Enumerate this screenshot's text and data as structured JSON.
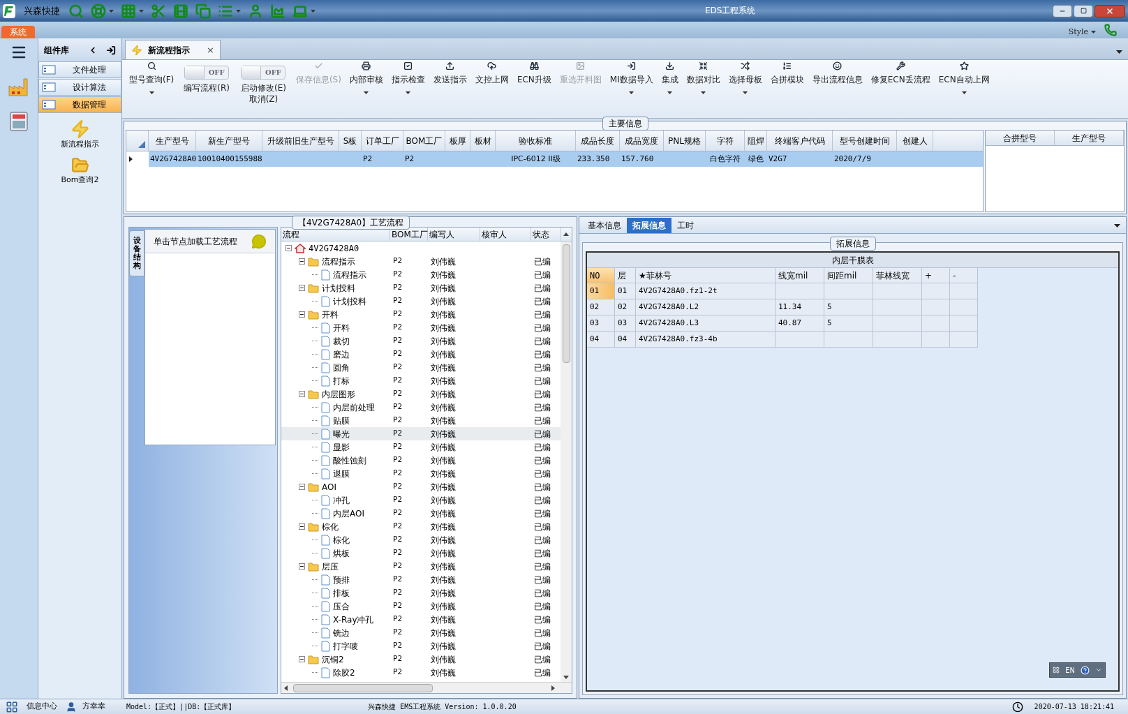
{
  "app": {
    "brand": "兴森快捷",
    "title": "EDS工程系统",
    "menu": "系统",
    "style": "Style"
  },
  "quick_icons": [
    {
      "dropdown": false
    },
    {
      "dropdown": true
    },
    {
      "dropdown": true
    },
    {
      "dropdown": false
    },
    {
      "dropdown": false
    },
    {
      "dropdown": false
    },
    {
      "dropdown": true
    },
    {
      "dropdown": false
    },
    {
      "dropdown": false
    },
    {
      "dropdown": true
    }
  ],
  "component_panel": {
    "title": "组件库",
    "items": [
      {
        "label": "文件处理",
        "selected": false
      },
      {
        "label": "设计算法",
        "selected": false
      },
      {
        "label": "数据管理",
        "selected": true
      }
    ],
    "launchers": [
      {
        "label": "新流程指示"
      },
      {
        "label": "Bom查询2"
      }
    ]
  },
  "doc_tabs": [
    {
      "label": "新流程指示",
      "selected": true,
      "close": "×"
    }
  ],
  "toolbar": [
    {
      "kind": "button",
      "label": "型号查询(F)",
      "dropdown": true,
      "disabled": false
    },
    {
      "kind": "toggle",
      "label": "编写流程(R)",
      "on": false,
      "state_text": "OFF"
    },
    {
      "kind": "toggle",
      "label": "启动修改(E)\n取消(Z)",
      "on": false,
      "state_text": "OFF"
    },
    {
      "kind": "button",
      "label": "保存信息(S)",
      "dropdown": false,
      "disabled": true
    },
    {
      "kind": "button",
      "label": "内部审核",
      "dropdown": true,
      "disabled": false
    },
    {
      "kind": "button",
      "label": "指示检查",
      "dropdown": true,
      "disabled": false
    },
    {
      "kind": "button",
      "label": "发送指示",
      "dropdown": false,
      "disabled": false
    },
    {
      "kind": "button",
      "label": "文控上网",
      "dropdown": false,
      "disabled": false
    },
    {
      "kind": "button",
      "label": "ECN升级",
      "dropdown": false,
      "disabled": false
    },
    {
      "kind": "button",
      "label": "重选开料图",
      "dropdown": false,
      "disabled": true
    },
    {
      "kind": "button",
      "label": "MI数据导入",
      "dropdown": true,
      "disabled": false
    },
    {
      "kind": "button",
      "label": "集成",
      "dropdown": true,
      "disabled": false
    },
    {
      "kind": "button",
      "label": "数据对比",
      "dropdown": true,
      "disabled": false
    },
    {
      "kind": "button",
      "label": "选择母板",
      "dropdown": true,
      "disabled": false
    },
    {
      "kind": "button",
      "label": "合拼模块",
      "dropdown": false,
      "disabled": false
    },
    {
      "kind": "button",
      "label": "导出流程信息",
      "dropdown": false,
      "disabled": false
    },
    {
      "kind": "button",
      "label": "修复ECN丢流程",
      "dropdown": false,
      "disabled": false
    },
    {
      "kind": "button",
      "label": "ECN自动上网",
      "dropdown": true,
      "disabled": false
    }
  ],
  "main_info": {
    "title": "主要信息",
    "columns": [
      "生产型号",
      "新生产型号",
      "升级前旧生产型号",
      "S板",
      "订单工厂",
      "BOM工厂",
      "板厚",
      "板材",
      "验收标准",
      "成品长度",
      "成品宽度",
      "PNL规格",
      "字符",
      "阻焊",
      "终端客户代码",
      "型号创建时间",
      "创建人"
    ],
    "rows": [
      {
        "selected": true,
        "cells": [
          "4V2G7428A0",
          "10010400155988",
          "",
          "",
          "P2",
          "P2",
          "",
          "",
          "IPC-6012 II级",
          "233.350",
          "157.760",
          "",
          "白色字符",
          "绿色",
          "V2G7",
          "2020/7/9",
          ""
        ]
      }
    ],
    "side_columns": [
      "合拼型号",
      "生产型号"
    ]
  },
  "process": {
    "title": "【4V2G7428A0】工艺流程",
    "side_tab": "设备结构",
    "hint": "单击节点加载工艺流程",
    "columns": [
      "流程",
      "BOM工厂",
      "编写人",
      "核审人",
      "状态"
    ],
    "tree": [
      {
        "label": "4V2G7428A0",
        "kind": "root",
        "expanded": true,
        "selected": false,
        "children": [
          {
            "label": "流程指示",
            "kind": "folder",
            "expanded": true,
            "selected": false,
            "bom": "P2",
            "writer": "刘伟巍",
            "status": "已编",
            "children": [
              {
                "label": "流程指示",
                "kind": "file",
                "selected": false,
                "bom": "P2",
                "writer": "刘伟巍",
                "status": "已编"
              }
            ]
          },
          {
            "label": "计划投料",
            "kind": "folder",
            "expanded": true,
            "selected": false,
            "bom": "P2",
            "writer": "刘伟巍",
            "status": "已编",
            "children": [
              {
                "label": "计划投料",
                "kind": "file",
                "selected": false,
                "bom": "P2",
                "writer": "刘伟巍",
                "status": "已编"
              }
            ]
          },
          {
            "label": "开料",
            "kind": "folder",
            "expanded": true,
            "selected": false,
            "bom": "P2",
            "writer": "刘伟巍",
            "status": "已编",
            "children": [
              {
                "label": "开料",
                "kind": "file",
                "selected": false,
                "bom": "P2",
                "writer": "刘伟巍",
                "status": "已编"
              },
              {
                "label": "裁切",
                "kind": "file",
                "selected": false,
                "bom": "P2",
                "writer": "刘伟巍",
                "status": "已编"
              },
              {
                "label": "磨边",
                "kind": "file",
                "selected": false,
                "bom": "P2",
                "writer": "刘伟巍",
                "status": "已编"
              },
              {
                "label": "圆角",
                "kind": "file",
                "selected": false,
                "bom": "P2",
                "writer": "刘伟巍",
                "status": "已编"
              },
              {
                "label": "打标",
                "kind": "file",
                "selected": false,
                "bom": "P2",
                "writer": "刘伟巍",
                "status": "已编"
              }
            ]
          },
          {
            "label": "内层图形",
            "kind": "folder",
            "expanded": true,
            "selected": false,
            "bom": "P2",
            "writer": "刘伟巍",
            "status": "已编",
            "children": [
              {
                "label": "内层前处理",
                "kind": "file",
                "selected": false,
                "bom": "P2",
                "writer": "刘伟巍",
                "status": "已编"
              },
              {
                "label": "贴膜",
                "kind": "file",
                "selected": false,
                "bom": "P2",
                "writer": "刘伟巍",
                "status": "已编"
              },
              {
                "label": "曝光",
                "kind": "file",
                "selected": true,
                "bom": "P2",
                "writer": "刘伟巍",
                "status": "已编"
              },
              {
                "label": "显影",
                "kind": "file",
                "selected": false,
                "bom": "P2",
                "writer": "刘伟巍",
                "status": "已编"
              },
              {
                "label": "酸性蚀刻",
                "kind": "file",
                "selected": false,
                "bom": "P2",
                "writer": "刘伟巍",
                "status": "已编"
              },
              {
                "label": "退膜",
                "kind": "file",
                "selected": false,
                "bom": "P2",
                "writer": "刘伟巍",
                "status": "已编"
              }
            ]
          },
          {
            "label": "AOI",
            "kind": "folder",
            "expanded": true,
            "selected": false,
            "bom": "P2",
            "writer": "刘伟巍",
            "status": "已编",
            "children": [
              {
                "label": "冲孔",
                "kind": "file",
                "selected": false,
                "bom": "P2",
                "writer": "刘伟巍",
                "status": "已编"
              },
              {
                "label": "内层AOI",
                "kind": "file",
                "selected": false,
                "bom": "P2",
                "writer": "刘伟巍",
                "status": "已编"
              }
            ]
          },
          {
            "label": "棕化",
            "kind": "folder",
            "expanded": true,
            "selected": false,
            "bom": "P2",
            "writer": "刘伟巍",
            "status": "已编",
            "children": [
              {
                "label": "棕化",
                "kind": "file",
                "selected": false,
                "bom": "P2",
                "writer": "刘伟巍",
                "status": "已编"
              },
              {
                "label": "烘板",
                "kind": "file",
                "selected": false,
                "bom": "P2",
                "writer": "刘伟巍",
                "status": "已编"
              }
            ]
          },
          {
            "label": "层压",
            "kind": "folder",
            "expanded": true,
            "selected": false,
            "bom": "P2",
            "writer": "刘伟巍",
            "status": "已编",
            "children": [
              {
                "label": "预排",
                "kind": "file",
                "selected": false,
                "bom": "P2",
                "writer": "刘伟巍",
                "status": "已编"
              },
              {
                "label": "排板",
                "kind": "file",
                "selected": false,
                "bom": "P2",
                "writer": "刘伟巍",
                "status": "已编"
              },
              {
                "label": "压合",
                "kind": "file",
                "selected": false,
                "bom": "P2",
                "writer": "刘伟巍",
                "status": "已编"
              },
              {
                "label": "X-Ray冲孔",
                "kind": "file",
                "selected": false,
                "bom": "P2",
                "writer": "刘伟巍",
                "status": "已编"
              },
              {
                "label": "铣边",
                "kind": "file",
                "selected": false,
                "bom": "P2",
                "writer": "刘伟巍",
                "status": "已编"
              },
              {
                "label": "打字唛",
                "kind": "file",
                "selected": false,
                "bom": "P2",
                "writer": "刘伟巍",
                "status": "已编"
              }
            ]
          },
          {
            "label": "沉铜2",
            "kind": "folder",
            "expanded": true,
            "selected": false,
            "bom": "P2",
            "writer": "刘伟巍",
            "status": "已编",
            "children": [
              {
                "label": "除胶2",
                "kind": "file",
                "selected": false,
                "bom": "P2",
                "writer": "刘伟巍",
                "status": "已编"
              }
            ]
          }
        ]
      }
    ]
  },
  "detail": {
    "tabs": [
      {
        "label": "基本信息",
        "selected": false
      },
      {
        "label": "拓展信息",
        "selected": true
      },
      {
        "label": "工时",
        "selected": false
      }
    ],
    "group_title": "拓展信息",
    "table_title": "内层干膜表",
    "columns": [
      "NO",
      "层",
      "★菲林号",
      "线宽mil",
      "间距mil",
      "菲林线宽",
      "+",
      "-"
    ],
    "rows": [
      {
        "selected": true,
        "cells": [
          "01",
          "01",
          "4V2G7428A0.fz1-2t",
          "",
          "",
          "",
          "",
          ""
        ]
      },
      {
        "selected": false,
        "cells": [
          "02",
          "02",
          "4V2G7428A0.L2",
          "11.34",
          "5",
          "",
          "",
          ""
        ]
      },
      {
        "selected": false,
        "cells": [
          "03",
          "03",
          "4V2G7428A0.L3",
          "40.87",
          "5",
          "",
          "",
          ""
        ]
      },
      {
        "selected": false,
        "cells": [
          "04",
          "04",
          "4V2G7428A0.fz3-4b",
          "",
          "",
          "",
          "",
          ""
        ]
      }
    ],
    "language": "EN"
  },
  "status_bar": {
    "info_center": "信息中心",
    "user": "方幸幸",
    "model": "Model:【正式】||DB:【正式库】",
    "version": "兴森快捷 EMS工程系统 Version: 1.0.0.20",
    "datetime": "2020-07-13 18:21:41"
  }
}
